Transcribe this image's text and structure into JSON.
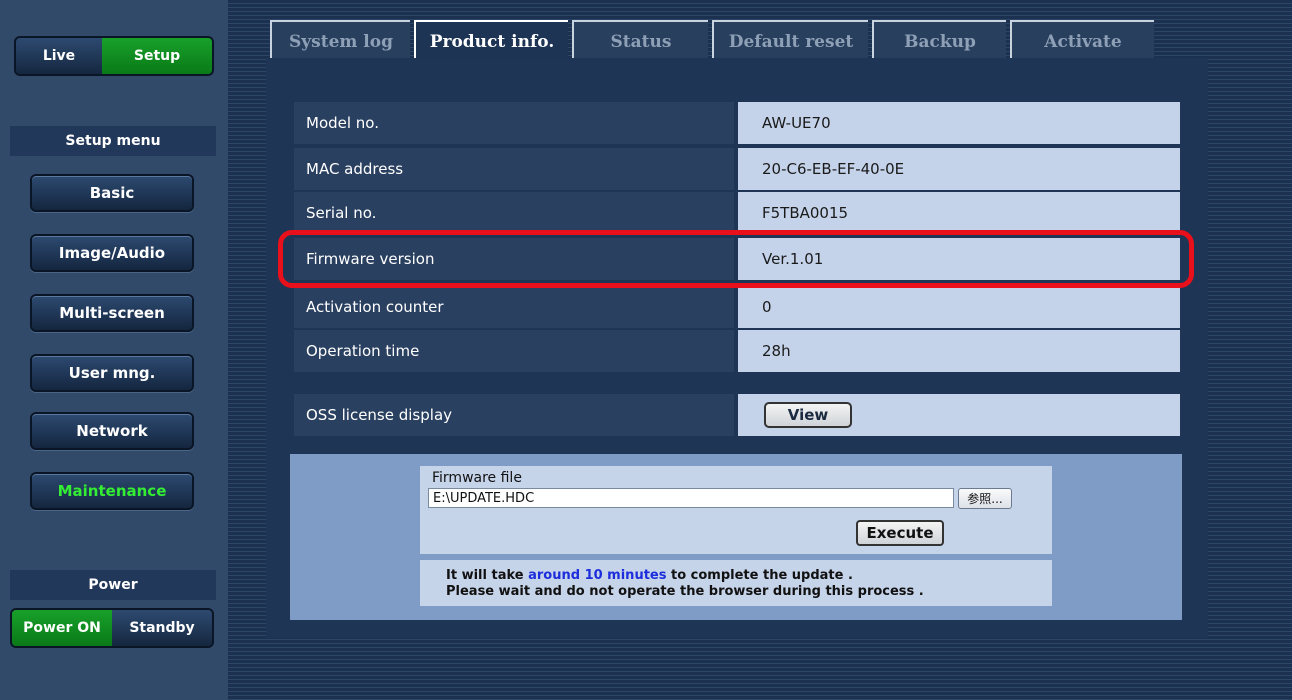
{
  "mode_switch": {
    "live": "Live",
    "setup": "Setup"
  },
  "setup_menu": {
    "title": "Setup menu",
    "items": [
      "Basic",
      "Image/Audio",
      "Multi-screen",
      "User mng.",
      "Network",
      "Maintenance"
    ],
    "active": "Maintenance"
  },
  "power": {
    "title": "Power",
    "on": "Power ON",
    "standby": "Standby"
  },
  "tabs": [
    "System log",
    "Product info.",
    "Status",
    "Default reset",
    "Backup",
    "Activate"
  ],
  "active_tab": "Product info.",
  "product_info": {
    "rows": [
      {
        "label": "Model no.",
        "value": "AW-UE70"
      },
      {
        "label": "MAC address",
        "value": "20-C6-EB-EF-40-0E"
      },
      {
        "label": "Serial no.",
        "value": "F5TBA0015"
      },
      {
        "label": "Firmware version",
        "value": "Ver.1.01"
      },
      {
        "label": "Activation counter",
        "value": "0"
      },
      {
        "label": "Operation time",
        "value": "28h"
      }
    ],
    "oss": {
      "label": "OSS license display",
      "button": "View"
    }
  },
  "firmware": {
    "label": "Firmware file",
    "value": "E:\\UPDATE.HDC",
    "browse": "参照...",
    "execute": "Execute",
    "note_pre": "It will take ",
    "note_highlight": "around 10 minutes",
    "note_post": " to complete the update .",
    "note_line2": "Please wait and do not operate the browser during this process ."
  },
  "colors": {
    "active_green": "#33ee33",
    "highlight_red": "#e8101a",
    "link_blue": "#1c2edc"
  }
}
